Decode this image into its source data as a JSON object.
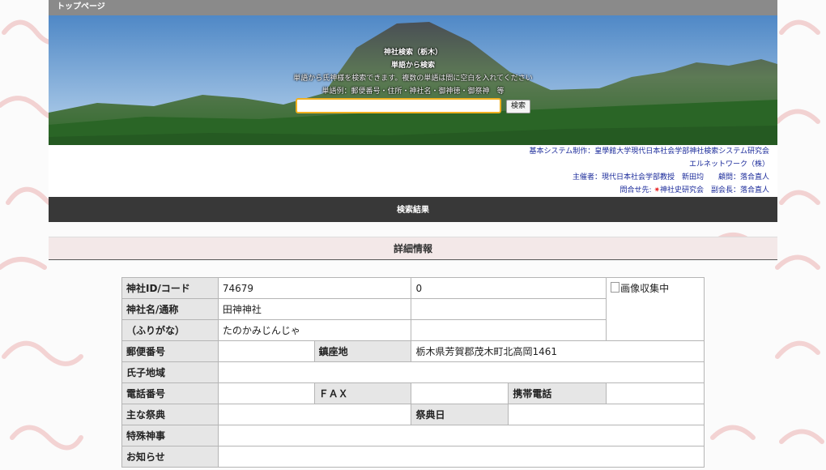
{
  "topbar": {
    "title": "トップページ"
  },
  "hero": {
    "line1": "神社検索（栃木）",
    "line2": "単語から検索",
    "line3": "単語から氏神様を検索できます。複数の単語は間に空白を入れてください",
    "line4": "単語例：郵便番号・住所・神社名・御神徳・御祭神　等",
    "search_value": "",
    "search_button": "検索"
  },
  "credits": {
    "line1": "基本システム制作：皇學館大学現代日本社会学部神社検索システム研究会",
    "line2": "エルネットワーク（株）",
    "line3": "主催者：現代日本社会学部教授　新田均　　顧問：落合直人",
    "line4_prefix": "問合せ先: ",
    "line4_star": "✷",
    "line4_rest": "神社史研究会　副会長：落合直人"
  },
  "result_bar": "検索結果",
  "detail_bar": "詳細情報",
  "table": {
    "id_label": "神社ID/コード",
    "id_value": "74679",
    "code_value": "0",
    "image_alt": "画像収集中",
    "name_label": "神社名/通称",
    "name_value": "田神神社",
    "furigana_label": "（ふりがな）",
    "furigana_value": "たのかみじんじゃ",
    "postal_label": "郵便番号",
    "location_label": "鎮座地",
    "location_value": "栃木県芳賀郡茂木町北高岡1461",
    "ujiko_label": "氏子地域",
    "phone_label": "電話番号",
    "fax_label": "ＦＡＸ",
    "mobile_label": "携帯電話",
    "festival_label": "主な祭典",
    "festival_day_label": "祭典日",
    "special_label": "特殊神事",
    "notice_label": "お知らせ"
  },
  "colors": {
    "topbar": "#8a8a8a",
    "result_bar": "#383838",
    "detail_bar": "#f3e8e8",
    "label_cell": "#e6e6e6",
    "credit_link": "#1a2a9a",
    "search_border": "#f0b020"
  }
}
